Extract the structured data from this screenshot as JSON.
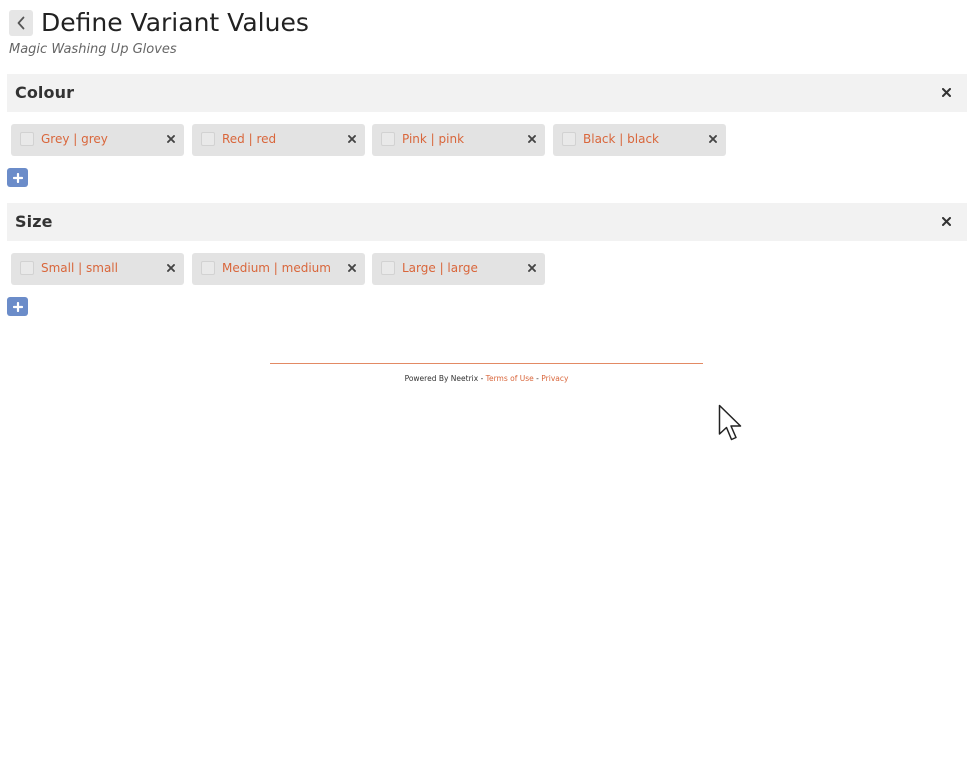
{
  "header": {
    "title": "Define Variant Values",
    "subtitle": "Magic Washing Up Gloves",
    "back_icon": "chevron-left-icon"
  },
  "sections": [
    {
      "title": "Colour",
      "values": [
        {
          "label": "Grey | grey"
        },
        {
          "label": "Red | red"
        },
        {
          "label": "Pink | pink"
        },
        {
          "label": "Black | black"
        }
      ]
    },
    {
      "title": "Size",
      "values": [
        {
          "label": "Small | small"
        },
        {
          "label": "Medium | medium"
        },
        {
          "label": "Large | large"
        }
      ]
    }
  ],
  "footer": {
    "powered_by": "Powered By Neetrix -",
    "separator": "-",
    "terms": "Terms of Use",
    "privacy": "Privacy"
  },
  "colors": {
    "accent": "#d9663b",
    "add_button": "#6b8cc9",
    "section_bar": "#f2f2f2",
    "chip_bg": "#e3e3e3"
  }
}
